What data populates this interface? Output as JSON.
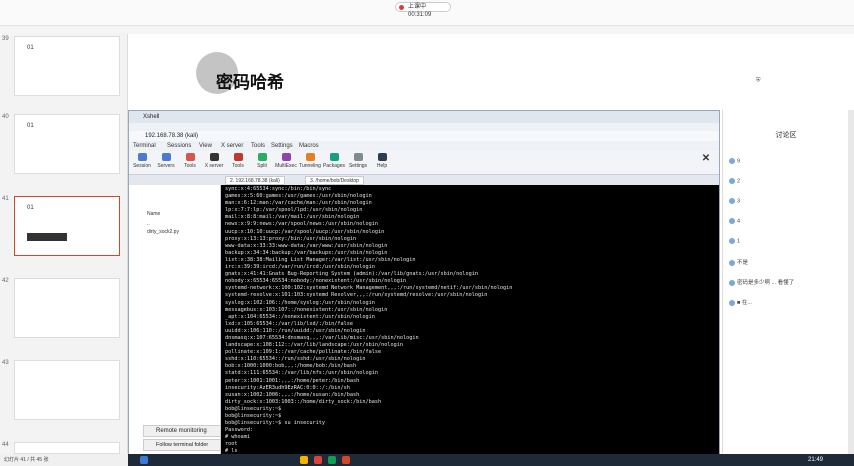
{
  "ppt": {
    "live_badge": "上课中 00:31:09",
    "slide_title": "密码哈希",
    "slide_numbers": [
      "39",
      "40",
      "41",
      "42",
      "43",
      "44"
    ],
    "thumb_titles": [
      "01",
      "01",
      "01",
      "",
      "",
      ""
    ],
    "status": "幻灯片 41 / 共 45 张"
  },
  "xshell": {
    "title": "Xshell",
    "address": "192.168.78.38 (kali)",
    "menu": [
      "Terminal",
      "Sessions",
      "View",
      "X server",
      "Tools",
      "Settings",
      "Macros"
    ],
    "toolbar": [
      "Session",
      "Servers",
      "Tools",
      "X server",
      "Tools",
      "Split",
      "MultiExec",
      "Tunneling",
      "Packages",
      "Settings",
      "Help"
    ],
    "tabs": [
      "2. 192.168.78.38 (kali)",
      "3. /home/bob/Desktop"
    ],
    "sftp_rows": [
      "Name",
      "..",
      "dirty_sock2.py"
    ],
    "remote_label": "Remote monitoring",
    "follow_label": "Follow terminal folder"
  },
  "terminal": {
    "lines": [
      "sync:x:4:65534:sync:/bin:/bin/sync",
      "games:x:5:60:games:/usr/games:/usr/sbin/nologin",
      "man:x:6:12:man:/var/cache/man:/usr/sbin/nologin",
      "lp:x:7:7:lp:/var/spool/lpd:/usr/sbin/nologin",
      "mail:x:8:8:mail:/var/mail:/usr/sbin/nologin",
      "news:x:9:9:news:/var/spool/news:/usr/sbin/nologin",
      "uucp:x:10:10:uucp:/var/spool/uucp:/usr/sbin/nologin",
      "proxy:x:13:13:proxy:/bin:/usr/sbin/nologin",
      "www-data:x:33:33:www-data:/var/www:/usr/sbin/nologin",
      "backup:x:34:34:backup:/var/backups:/usr/sbin/nologin",
      "list:x:38:38:Mailing List Manager:/var/list:/usr/sbin/nologin",
      "irc:x:39:39:ircd:/var/run/ircd:/usr/sbin/nologin",
      "gnats:x:41:41:Gnats Bug-Reporting System (admin):/var/lib/gnats:/usr/sbin/nologin",
      "nobody:x:65534:65534:nobody:/nonexistent:/usr/sbin/nologin",
      "systemd-network:x:100:102:systemd Network Management,,,:/run/systemd/netif:/usr/sbin/nologin",
      "systemd-resolve:x:101:103:systemd Resolver,,,:/run/systemd/resolve:/usr/sbin/nologin",
      "syslog:x:102:106::/home/syslog:/usr/sbin/nologin",
      "messagebus:x:103:107::/nonexistent:/usr/sbin/nologin",
      "_apt:x:104:65534::/nonexistent:/usr/sbin/nologin",
      "lxd:x:105:65534::/var/lib/lxd/:/bin/false",
      "uuidd:x:106:110::/run/uuidd:/usr/sbin/nologin",
      "dnsmasq:x:107:65534:dnsmasq,,,:/var/lib/misc:/usr/sbin/nologin",
      "landscape:x:108:112::/var/lib/landscape:/usr/sbin/nologin",
      "pollinate:x:109:1::/var/cache/pollinate:/bin/false",
      "sshd:x:110:65534::/run/sshd:/usr/sbin/nologin",
      "bob:x:1000:1000:bob,,,:/home/bob:/bin/bash",
      "statd:x:111:65534::/var/lib/nfs:/usr/sbin/nologin",
      "peter:x:1001:1001:,,,:/home/peter:/bin/bash",
      "insecurity:AzER3udh9EzRAC:0:0::/:/bin/sh",
      "susan:x:1002:1006:,,,:/home/susan:/bin/bash",
      "dirty_sock:x:1003:1003::/home/dirty_sock:/bin/bash",
      "bob@linsecurity:~$",
      "bob@linsecurity:~$",
      "bob@linsecurity:~$ su insecurity",
      "Password:",
      "# whoami",
      "root",
      "# ls",
      "dirty_sock2.py",
      "# "
    ]
  },
  "chat": {
    "header": "讨论区",
    "items": [
      "9",
      "2",
      "3",
      "4",
      "1",
      "不是",
      "密码是多少啊 ... 看懂了",
      "■ 在..."
    ]
  },
  "taskbar": {
    "clock": "21:49"
  },
  "colors": {
    "accent": "#d24726",
    "terminal_bg": "#000000"
  }
}
